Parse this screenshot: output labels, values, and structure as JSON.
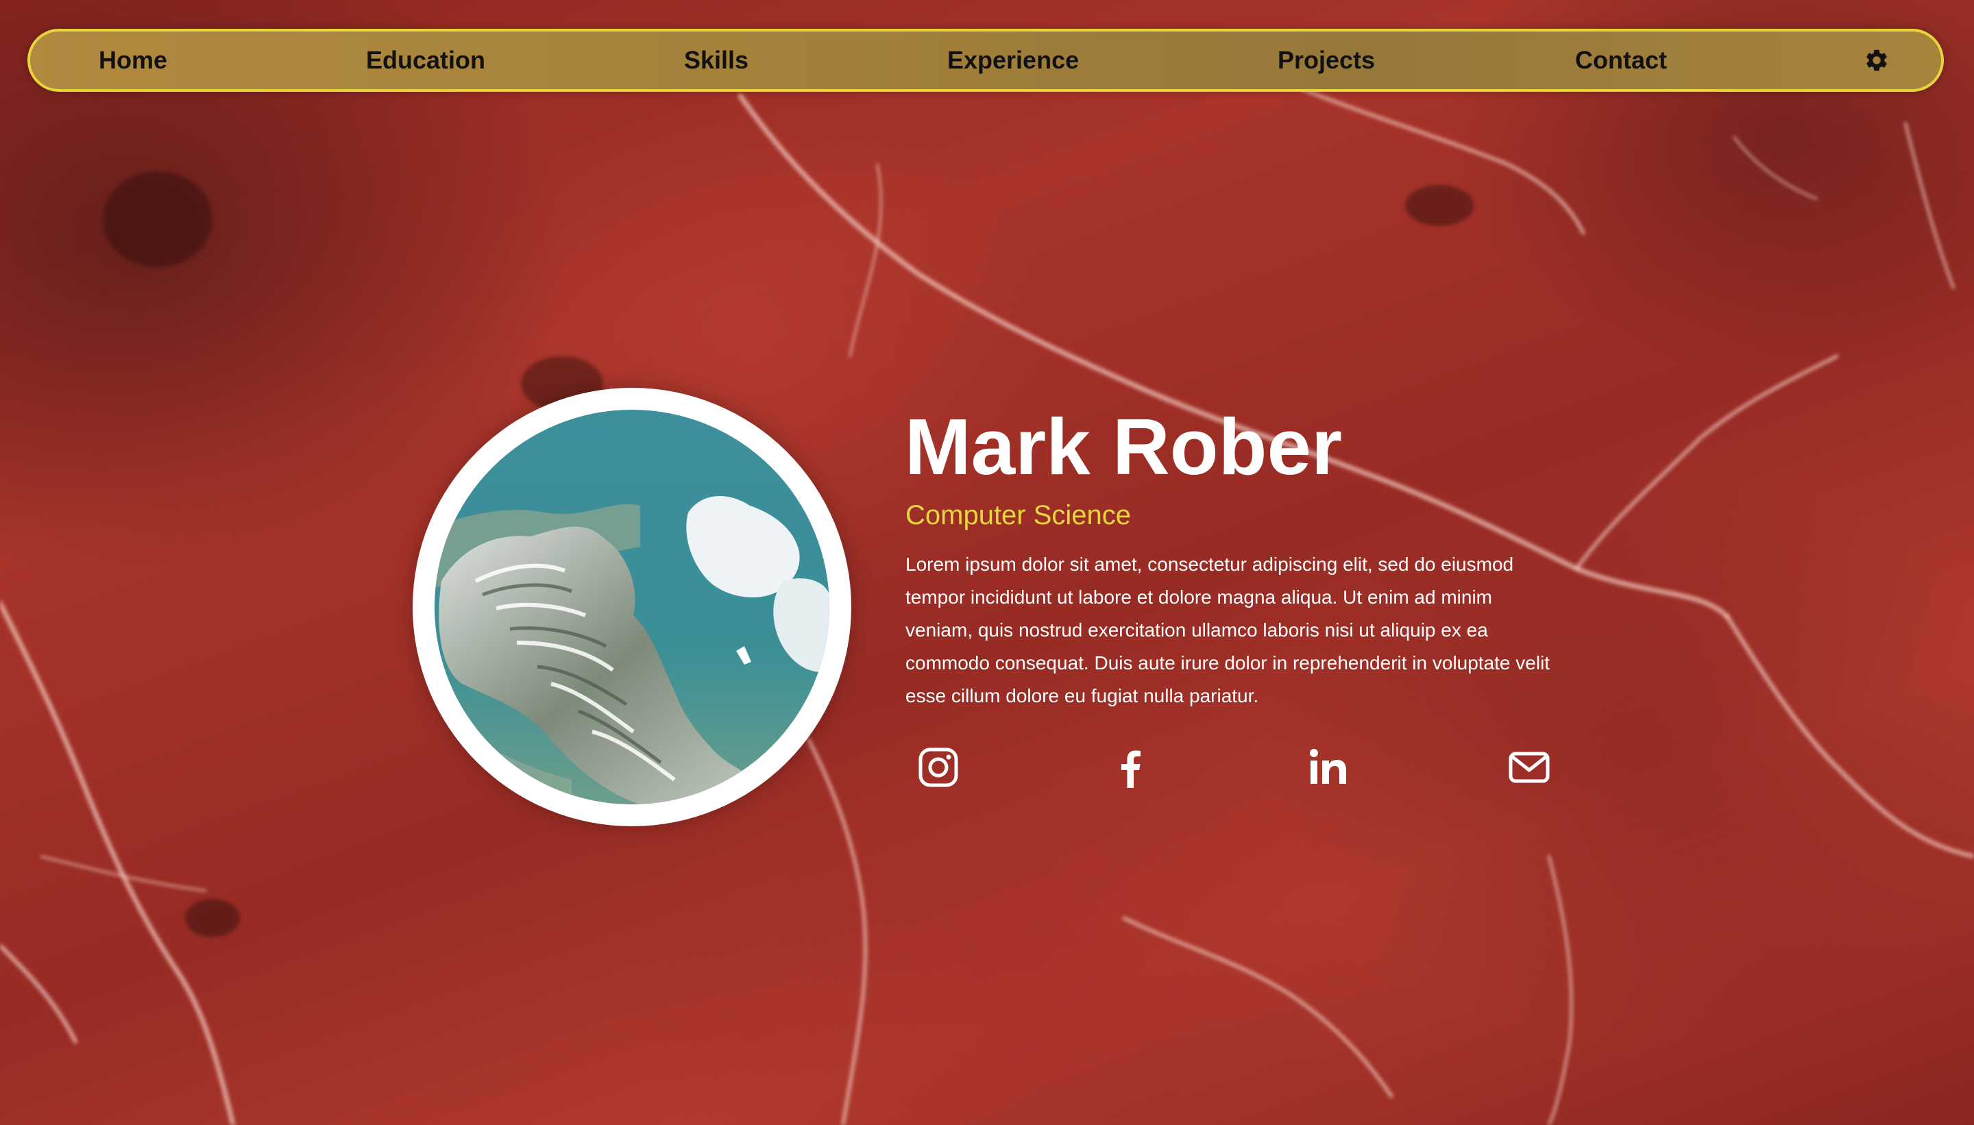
{
  "nav": {
    "items": [
      {
        "label": "Home"
      },
      {
        "label": "Education"
      },
      {
        "label": "Skills"
      },
      {
        "label": "Experience"
      },
      {
        "label": "Projects"
      },
      {
        "label": "Contact"
      }
    ],
    "settings_icon": "gear-icon"
  },
  "profile": {
    "name": "Mark Rober",
    "subtitle": "Computer Science",
    "bio": "Lorem ipsum dolor sit amet, consectetur adipiscing elit, sed do eiusmod tempor incididunt ut labore et dolore magna aliqua. Ut enim ad minim veniam, quis nostrud exercitation ullamco laboris nisi ut aliquip ex ea commodo consequat. Duis aute irure dolor in reprehenderit in voluptate velit esse cillum dolore eu fugiat nulla pariatur."
  },
  "social": [
    {
      "icon": "instagram-icon"
    },
    {
      "icon": "facebook-icon"
    },
    {
      "icon": "linkedin-icon"
    },
    {
      "icon": "email-icon"
    }
  ],
  "colors": {
    "nav_border": "#e6d53a",
    "nav_bg": "#a3813a",
    "accent": "#e8d640",
    "background": "#9a2a22"
  }
}
